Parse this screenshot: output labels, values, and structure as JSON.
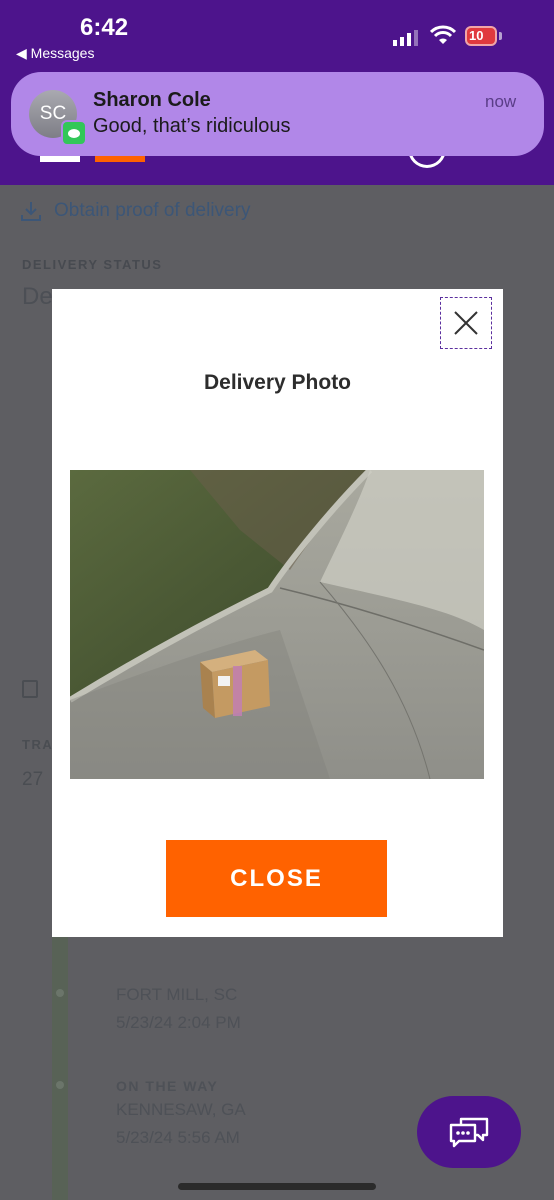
{
  "status_bar": {
    "time": "6:42",
    "back_app": "◀ Messages",
    "battery": "10"
  },
  "notification": {
    "avatar_initials": "SC",
    "sender": "Sharon Cole",
    "message": "Good, that’s ridiculous",
    "time": "now",
    "app_icon": "messages-icon"
  },
  "page": {
    "proof_link": "Obtain proof of delivery",
    "delivery_status_label": "DELIVERY STATUS",
    "delivery_status_value": "De",
    "tracking_label": "TRA",
    "tracking_value": "27",
    "events": [
      {
        "location": "FORT MILL, SC",
        "datetime": "5/23/24 2:04 PM"
      },
      {
        "status": "ON THE WAY",
        "location": "KENNESAW, GA",
        "datetime": "5/23/24 5:56 AM"
      }
    ]
  },
  "modal": {
    "title": "Delivery Photo",
    "close_label": "CLOSE",
    "close_icon": "close-icon",
    "photo_alt": "Package on sidewalk"
  },
  "colors": {
    "brand_purple": "#4d148c",
    "accent_orange": "#ff6200",
    "overlay_gray": "#5e5e62",
    "notification_bg": "#b187e8"
  }
}
